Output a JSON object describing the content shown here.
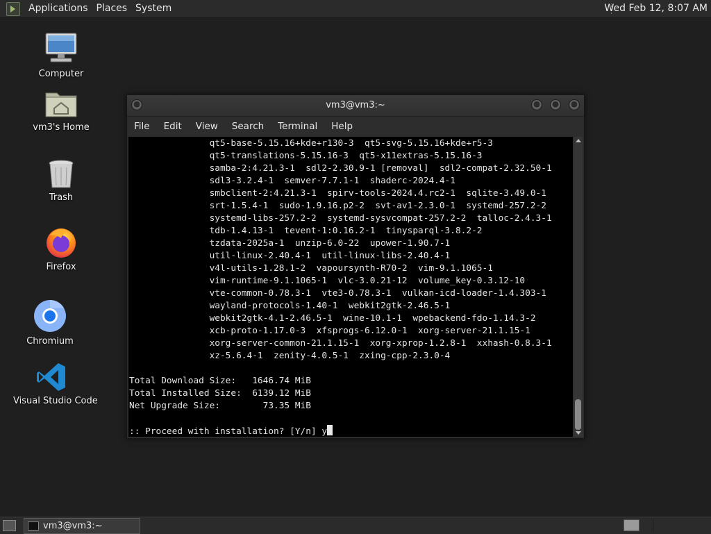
{
  "top_panel": {
    "menus": [
      "Applications",
      "Places",
      "System"
    ],
    "clock": "Wed Feb 12,  8:07 AM"
  },
  "desktop_icons": [
    {
      "label": "Computer",
      "icon": "computer-icon"
    },
    {
      "label": "vm3's Home",
      "icon": "home-folder-icon"
    },
    {
      "label": "Trash",
      "icon": "trash-icon"
    },
    {
      "label": "Firefox",
      "icon": "firefox-icon"
    },
    {
      "label": "Chromium",
      "icon": "chromium-icon"
    },
    {
      "label": "Visual Studio Code",
      "icon": "vscode-icon"
    }
  ],
  "terminal": {
    "title": "vm3@vm3:~",
    "menus": [
      "File",
      "Edit",
      "View",
      "Search",
      "Terminal",
      "Help"
    ],
    "lines": [
      "               qt5-base-5.15.16+kde+r130-3  qt5-svg-5.15.16+kde+r5-3",
      "               qt5-translations-5.15.16-3  qt5-x11extras-5.15.16-3",
      "               samba-2:4.21.3-1  sdl2-2.30.9-1 [removal]  sdl2-compat-2.32.50-1",
      "               sdl3-3.2.4-1  semver-7.7.1-1  shaderc-2024.4-1",
      "               smbclient-2:4.21.3-1  spirv-tools-2024.4.rc2-1  sqlite-3.49.0-1",
      "               srt-1.5.4-1  sudo-1.9.16.p2-2  svt-av1-2.3.0-1  systemd-257.2-2",
      "               systemd-libs-257.2-2  systemd-sysvcompat-257.2-2  talloc-2.4.3-1",
      "               tdb-1.4.13-1  tevent-1:0.16.2-1  tinysparql-3.8.2-2",
      "               tzdata-2025a-1  unzip-6.0-22  upower-1.90.7-1",
      "               util-linux-2.40.4-1  util-linux-libs-2.40.4-1",
      "               v4l-utils-1.28.1-2  vapoursynth-R70-2  vim-9.1.1065-1",
      "               vim-runtime-9.1.1065-1  vlc-3.0.21-12  volume_key-0.3.12-10",
      "               vte-common-0.78.3-1  vte3-0.78.3-1  vulkan-icd-loader-1.4.303-1",
      "               wayland-protocols-1.40-1  webkit2gtk-2.46.5-1",
      "               webkit2gtk-4.1-2.46.5-1  wine-10.1-1  wpebackend-fdo-1.14.3-2",
      "               xcb-proto-1.17.0-3  xfsprogs-6.12.0-1  xorg-server-21.1.15-1",
      "               xorg-server-common-21.1.15-1  xorg-xprop-1.2.8-1  xxhash-0.8.3-1",
      "               xz-5.6.4-1  zenity-4.0.5-1  zxing-cpp-2.3.0-4",
      "",
      "Total Download Size:   1646.74 MiB",
      "Total Installed Size:  6139.12 MiB",
      "Net Upgrade Size:        73.35 MiB",
      "",
      ":: Proceed with installation? [Y/n] y"
    ]
  },
  "taskbar": {
    "tasks": [
      {
        "label": "vm3@vm3:~"
      }
    ]
  }
}
